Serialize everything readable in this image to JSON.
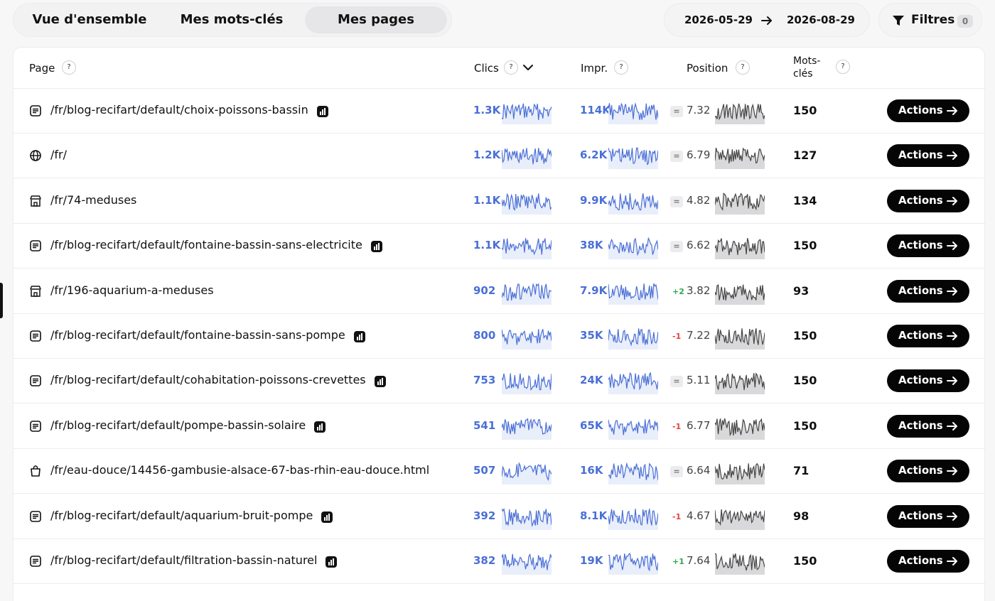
{
  "tabs": [
    {
      "label": "Vue d'ensemble",
      "active": false
    },
    {
      "label": "Mes mots-clés",
      "active": false
    },
    {
      "label": "Mes pages",
      "active": true
    }
  ],
  "date_range": {
    "start": "2026-05-29",
    "end": "2026-08-29"
  },
  "filters": {
    "label": "Filtres",
    "count": "0"
  },
  "columns": {
    "page": "Page",
    "clicks": "Clics",
    "impressions": "Impr.",
    "position": "Position",
    "keywords_line1": "Mots-",
    "keywords_line2": "clés",
    "help": "?"
  },
  "colors": {
    "accent": "#4a6fd6",
    "positive": "#2fa84f",
    "negative": "#e0433a",
    "button": "#050505"
  },
  "action_label": "Actions",
  "rows": [
    {
      "icon": "article-icon",
      "page": "/fr/blog-recifart/default/choix-poissons-bassin",
      "stats": true,
      "clicks": "1.3K",
      "impressions": "114K",
      "change": "=",
      "position": "7.32",
      "keywords": "150"
    },
    {
      "icon": "globe-icon",
      "page": "/fr/",
      "stats": false,
      "clicks": "1.2K",
      "impressions": "6.2K",
      "change": "=",
      "position": "6.79",
      "keywords": "127"
    },
    {
      "icon": "store-icon",
      "page": "/fr/74-meduses",
      "stats": false,
      "clicks": "1.1K",
      "impressions": "9.9K",
      "change": "=",
      "position": "4.82",
      "keywords": "134"
    },
    {
      "icon": "article-icon",
      "page": "/fr/blog-recifart/default/fontaine-bassin-sans-electricite",
      "stats": true,
      "clicks": "1.1K",
      "impressions": "38K",
      "change": "=",
      "position": "6.62",
      "keywords": "150"
    },
    {
      "icon": "store-icon",
      "page": "/fr/196-aquarium-a-meduses",
      "stats": false,
      "clicks": "902",
      "impressions": "7.9K",
      "change": "+2",
      "position": "3.82",
      "keywords": "93"
    },
    {
      "icon": "article-icon",
      "page": "/fr/blog-recifart/default/fontaine-bassin-sans-pompe",
      "stats": true,
      "clicks": "800",
      "impressions": "35K",
      "change": "-1",
      "position": "7.22",
      "keywords": "150"
    },
    {
      "icon": "article-icon",
      "page": "/fr/blog-recifart/default/cohabitation-poissons-crevettes",
      "stats": true,
      "clicks": "753",
      "impressions": "24K",
      "change": "=",
      "position": "5.11",
      "keywords": "150"
    },
    {
      "icon": "article-icon",
      "page": "/fr/blog-recifart/default/pompe-bassin-solaire",
      "stats": true,
      "clicks": "541",
      "impressions": "65K",
      "change": "-1",
      "position": "6.77",
      "keywords": "150"
    },
    {
      "icon": "shopping-bag-icon",
      "page": "/fr/eau-douce/14456-gambusie-alsace-67-bas-rhin-eau-douce.html",
      "stats": false,
      "clicks": "507",
      "impressions": "16K",
      "change": "=",
      "position": "6.64",
      "keywords": "71"
    },
    {
      "icon": "article-icon",
      "page": "/fr/blog-recifart/default/aquarium-bruit-pompe",
      "stats": true,
      "clicks": "392",
      "impressions": "8.1K",
      "change": "-1",
      "position": "4.67",
      "keywords": "98"
    },
    {
      "icon": "article-icon",
      "page": "/fr/blog-recifart/default/filtration-bassin-naturel",
      "stats": true,
      "clicks": "382",
      "impressions": "19K",
      "change": "+1",
      "position": "7.64",
      "keywords": "150"
    }
  ]
}
